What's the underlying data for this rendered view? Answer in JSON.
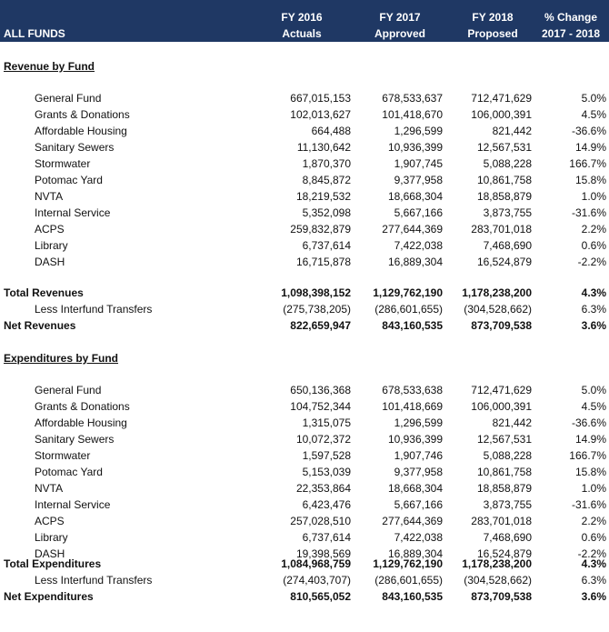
{
  "header": {
    "title": "ALL FUNDS",
    "col1": [
      "FY 2016",
      "Actuals"
    ],
    "col2": [
      "FY 2017",
      "Approved"
    ],
    "col3": [
      "FY 2018",
      "Proposed"
    ],
    "col4": [
      "% Change",
      "2017 - 2018"
    ]
  },
  "revenue": {
    "title": "Revenue by Fund",
    "rows": [
      {
        "label": "General Fund",
        "fy16": "667,015,153",
        "fy17": "678,533,637",
        "fy18": "712,471,629",
        "pct": "5.0%"
      },
      {
        "label": "Grants & Donations",
        "fy16": "102,013,627",
        "fy17": "101,418,670",
        "fy18": "106,000,391",
        "pct": "4.5%"
      },
      {
        "label": "Affordable Housing",
        "fy16": "664,488",
        "fy17": "1,296,599",
        "fy18": "821,442",
        "pct": "-36.6%"
      },
      {
        "label": "Sanitary Sewers",
        "fy16": "11,130,642",
        "fy17": "10,936,399",
        "fy18": "12,567,531",
        "pct": "14.9%"
      },
      {
        "label": "Stormwater",
        "fy16": "1,870,370",
        "fy17": "1,907,745",
        "fy18": "5,088,228",
        "pct": "166.7%"
      },
      {
        "label": "Potomac Yard",
        "fy16": "8,845,872",
        "fy17": "9,377,958",
        "fy18": "10,861,758",
        "pct": "15.8%"
      },
      {
        "label": "NVTA",
        "fy16": "18,219,532",
        "fy17": "18,668,304",
        "fy18": "18,858,879",
        "pct": "1.0%"
      },
      {
        "label": "Internal Service",
        "fy16": "5,352,098",
        "fy17": "5,667,166",
        "fy18": "3,873,755",
        "pct": "-31.6%"
      },
      {
        "label": "ACPS",
        "fy16": "259,832,879",
        "fy17": "277,644,369",
        "fy18": "283,701,018",
        "pct": "2.2%"
      },
      {
        "label": "Library",
        "fy16": "6,737,614",
        "fy17": "7,422,038",
        "fy18": "7,468,690",
        "pct": "0.6%"
      },
      {
        "label": "DASH",
        "fy16": "16,715,878",
        "fy17": "16,889,304",
        "fy18": "16,524,879",
        "pct": "-2.2%"
      }
    ],
    "total": {
      "label": "Total Revenues",
      "fy16": "1,098,398,152",
      "fy17": "1,129,762,190",
      "fy18": "1,178,238,200",
      "pct": "4.3%"
    },
    "less": {
      "label": "Less Interfund Transfers",
      "fy16": "(275,738,205)",
      "fy17": "(286,601,655)",
      "fy18": "(304,528,662)",
      "pct": "6.3%"
    },
    "net": {
      "label": "Net Revenues",
      "fy16": "822,659,947",
      "fy17": "843,160,535",
      "fy18": "873,709,538",
      "pct": "3.6%"
    }
  },
  "expenditures": {
    "title": "Expenditures by Fund",
    "rows": [
      {
        "label": "General Fund",
        "fy16": "650,136,368",
        "fy17": "678,533,638",
        "fy18": "712,471,629",
        "pct": "5.0%"
      },
      {
        "label": "Grants & Donations",
        "fy16": "104,752,344",
        "fy17": "101,418,669",
        "fy18": "106,000,391",
        "pct": "4.5%"
      },
      {
        "label": "Affordable Housing",
        "fy16": "1,315,075",
        "fy17": "1,296,599",
        "fy18": "821,442",
        "pct": "-36.6%"
      },
      {
        "label": "Sanitary Sewers",
        "fy16": "10,072,372",
        "fy17": "10,936,399",
        "fy18": "12,567,531",
        "pct": "14.9%"
      },
      {
        "label": "Stormwater",
        "fy16": "1,597,528",
        "fy17": "1,907,746",
        "fy18": "5,088,228",
        "pct": "166.7%"
      },
      {
        "label": "Potomac Yard",
        "fy16": "5,153,039",
        "fy17": "9,377,958",
        "fy18": "10,861,758",
        "pct": "15.8%"
      },
      {
        "label": "NVTA",
        "fy16": "22,353,864",
        "fy17": "18,668,304",
        "fy18": "18,858,879",
        "pct": "1.0%"
      },
      {
        "label": "Internal Service",
        "fy16": "6,423,476",
        "fy17": "5,667,166",
        "fy18": "3,873,755",
        "pct": "-31.6%"
      },
      {
        "label": "ACPS",
        "fy16": "257,028,510",
        "fy17": "277,644,369",
        "fy18": "283,701,018",
        "pct": "2.2%"
      },
      {
        "label": "Library",
        "fy16": "6,737,614",
        "fy17": "7,422,038",
        "fy18": "7,468,690",
        "pct": "0.6%"
      },
      {
        "label": "DASH",
        "fy16": "19,398,569",
        "fy17": "16,889,304",
        "fy18": "16,524,879",
        "pct": "-2.2%"
      }
    ],
    "total": {
      "label": "Total Expenditures",
      "fy16": "1,084,968,759",
      "fy17": "1,129,762,190",
      "fy18": "1,178,238,200",
      "pct": "4.3%"
    },
    "less": {
      "label": "Less Interfund Transfers",
      "fy16": "(274,403,707)",
      "fy17": "(286,601,655)",
      "fy18": "(304,528,662)",
      "pct": "6.3%"
    },
    "net": {
      "label": "Net Expenditures",
      "fy16": "810,565,052",
      "fy17": "843,160,535",
      "fy18": "873,709,538",
      "pct": "3.6%"
    }
  }
}
